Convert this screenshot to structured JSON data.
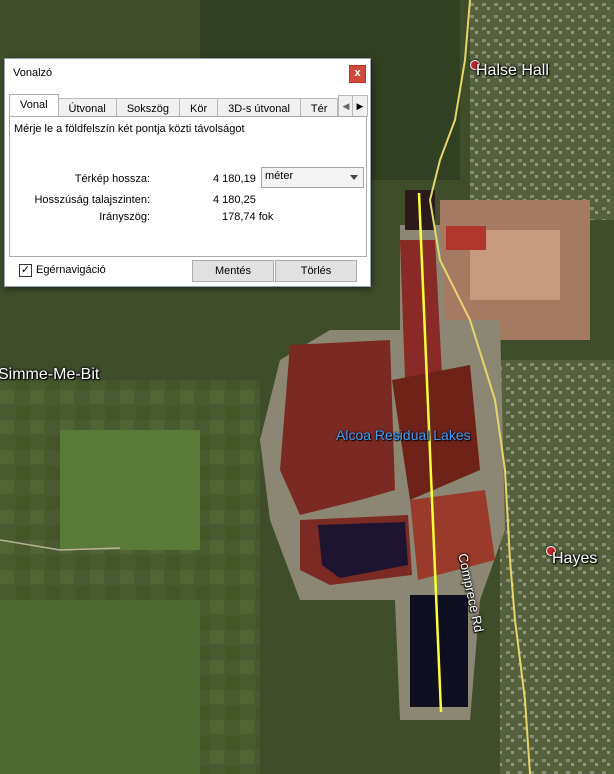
{
  "map": {
    "places": {
      "halse_hall": "Halse Hall",
      "simme_me_bit": "Simme-Me-Bit",
      "hayes": "Hayes",
      "alcoa": "Alcoa Residual Lakes",
      "road": "Comprece Rd"
    },
    "colors": {
      "measure_line": "#ffff33",
      "lake_label": "#3fa0ff",
      "pin": "#c0262e"
    }
  },
  "dialog": {
    "title": "Vonalzó",
    "close_label": "x",
    "tabs": [
      "Vonal",
      "Útvonal",
      "Sokszög",
      "Kör",
      "3D-s útvonal",
      "Tér"
    ],
    "active_tab": "Vonal",
    "description": "Mérje le a földfelszín két pontja közti távolságot",
    "map_length_label": "Térkép hossza:",
    "map_length_value": "4 180,19",
    "unit_value": "méter",
    "ground_length_label": "Hosszúság talajszinten:",
    "ground_length_value": "4 180,25",
    "heading_label": "Irányszög:",
    "heading_value": "178,74 fok",
    "mouse_nav_label": "Egérnavigáció",
    "mouse_nav_checked": true,
    "save_label": "Mentés",
    "clear_label": "Törlés"
  }
}
